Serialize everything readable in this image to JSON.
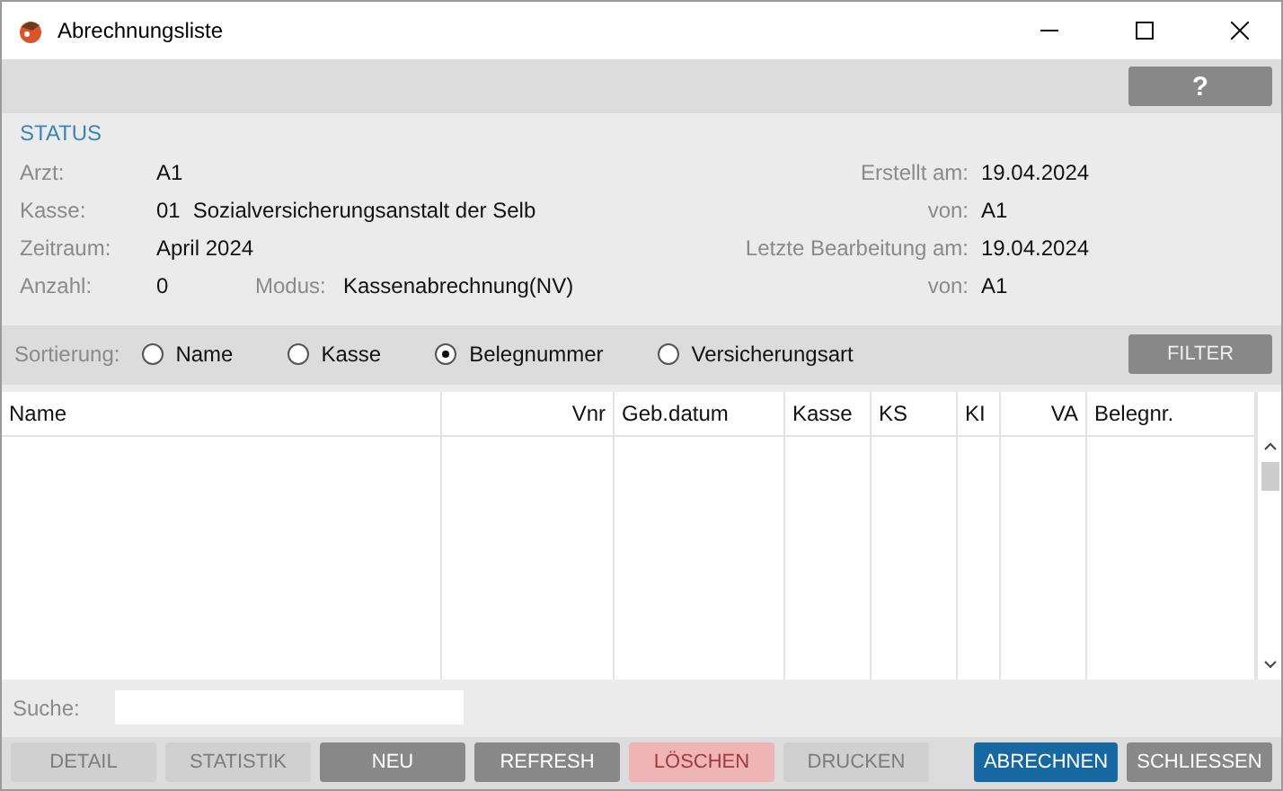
{
  "window": {
    "title": "Abrechnungsliste"
  },
  "help_button": "?",
  "status": {
    "heading": "STATUS",
    "left": [
      {
        "label": "Arzt:",
        "value": "A1"
      },
      {
        "label": "Kasse:",
        "code": "01",
        "value": "Sozialversicherungsanstalt der Selb"
      },
      {
        "label": "Zeitraum:",
        "value": "April 2024"
      },
      {
        "label": "Anzahl:",
        "value": "0"
      }
    ],
    "modus": {
      "label": "Modus:",
      "value": "Kassenabrechnung(NV)"
    },
    "right": [
      {
        "label": "Erstellt am:",
        "value": "19.04.2024"
      },
      {
        "label": "von:",
        "value": "A1"
      },
      {
        "label": "Letzte Bearbeitung am:",
        "value": "19.04.2024"
      },
      {
        "label": "von:",
        "value": "A1"
      }
    ]
  },
  "sorting": {
    "label": "Sortierung:",
    "options": [
      {
        "label": "Name",
        "selected": false
      },
      {
        "label": "Kasse",
        "selected": false
      },
      {
        "label": "Belegnummer",
        "selected": true
      },
      {
        "label": "Versicherungsart",
        "selected": false
      }
    ],
    "filter_button": "FILTER"
  },
  "table": {
    "columns": [
      {
        "label": "Name"
      },
      {
        "label": "Vnr"
      },
      {
        "label": "Geb.datum"
      },
      {
        "label": "Kasse"
      },
      {
        "label": "KS"
      },
      {
        "label": "KI"
      },
      {
        "label": "VA"
      },
      {
        "label": "Belegnr."
      }
    ]
  },
  "search": {
    "label": "Suche:"
  },
  "buttons": [
    {
      "label": "DETAIL",
      "kind": "default",
      "disabled": true
    },
    {
      "label": "STATISTIK",
      "kind": "default",
      "disabled": true
    },
    {
      "label": "NEU",
      "kind": "default",
      "disabled": false
    },
    {
      "label": "REFRESH",
      "kind": "default",
      "disabled": false
    },
    {
      "label": "LÖSCHEN",
      "kind": "danger",
      "disabled": true
    },
    {
      "label": "DRUCKEN",
      "kind": "default",
      "disabled": true
    },
    {
      "label": "ABRECHNEN",
      "kind": "primary",
      "disabled": false
    },
    {
      "label": "SCHLIESSEN",
      "kind": "default",
      "disabled": false
    }
  ]
}
